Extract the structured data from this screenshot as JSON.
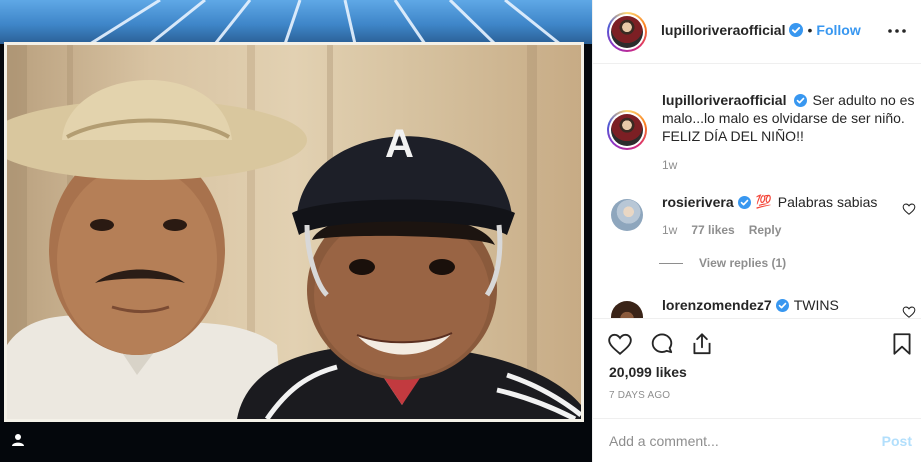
{
  "post": {
    "username": "lupilloriveraofficial",
    "separator": "•",
    "follow_label": "Follow",
    "more_icon": "more-options-icon",
    "caption": {
      "username": "lupilloriveraofficial",
      "text": "Ser adulto no es malo...lo malo es olvidarse de ser niño. FELIZ DÍA DEL NIÑO!!",
      "age": "1w"
    },
    "comments": [
      {
        "username": "rosierivera",
        "emoji": "💯",
        "text": "Palabras sabias",
        "age": "1w",
        "likes": "77 likes",
        "reply_label": "Reply",
        "view_replies": "View replies (1)"
      },
      {
        "username": "lorenzomendez7",
        "text": "TWINS"
      }
    ],
    "likes": "20,099 likes",
    "posted": "7 DAYS AGO",
    "add_comment_placeholder": "Add a comment...",
    "post_label": "Post"
  },
  "colors": {
    "accent": "#3897f0",
    "verified": "#3897f0",
    "muted": "#8e8e8e",
    "post_disabled": "#b2dffc"
  }
}
